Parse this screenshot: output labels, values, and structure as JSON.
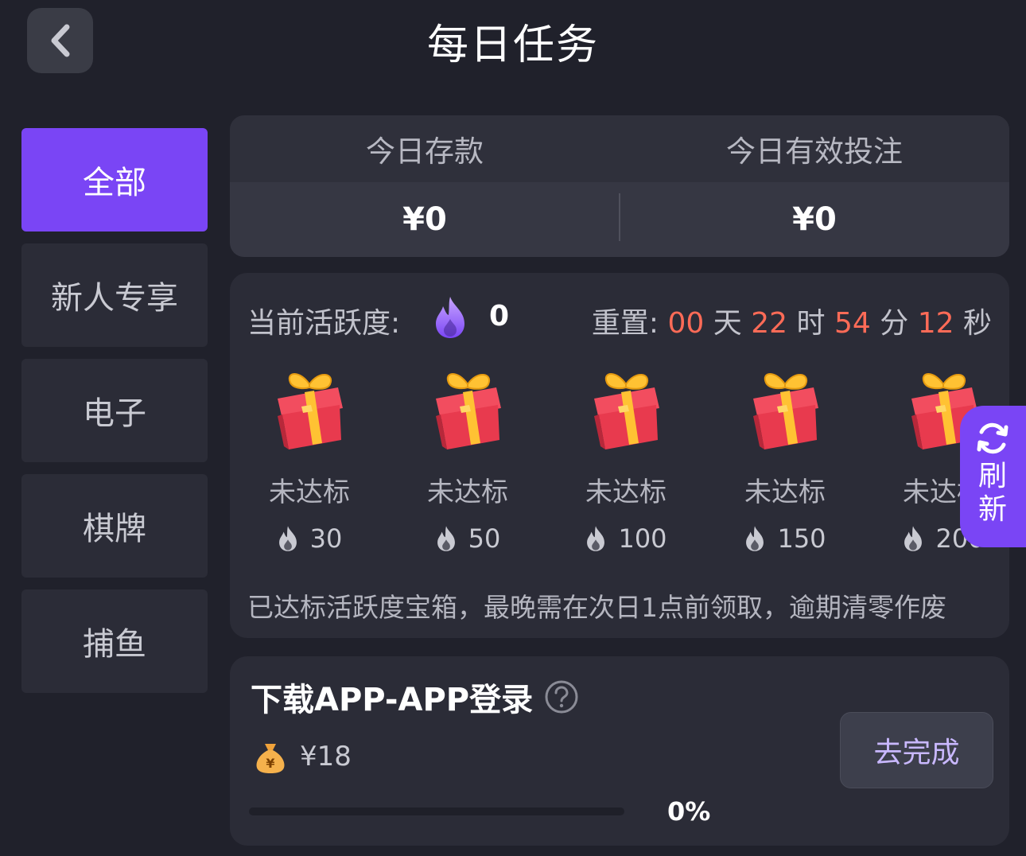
{
  "header": {
    "title": "每日任务",
    "back_icon": "chevron-left-icon"
  },
  "sidebar": {
    "items": [
      {
        "label": "全部",
        "active": true
      },
      {
        "label": "新人专享",
        "active": false
      },
      {
        "label": "电子",
        "active": false
      },
      {
        "label": "棋牌",
        "active": false
      },
      {
        "label": "捕鱼",
        "active": false
      }
    ]
  },
  "stats": {
    "deposit_label": "今日存款",
    "deposit_value": "¥0",
    "bet_label": "今日有效投注",
    "bet_value": "¥0"
  },
  "activity": {
    "label": "当前活跃度:",
    "value": "0",
    "reset_label": "重置:",
    "reset": {
      "days": "00",
      "days_unit": "天",
      "hours": "22",
      "hours_unit": "时",
      "minutes": "54",
      "minutes_unit": "分",
      "seconds": "12",
      "seconds_unit": "秒"
    },
    "rewards": [
      {
        "status": "未达标",
        "required": "30"
      },
      {
        "status": "未达标",
        "required": "50"
      },
      {
        "status": "未达标",
        "required": "100"
      },
      {
        "status": "未达标",
        "required": "150"
      },
      {
        "status": "未达标",
        "required": "200"
      }
    ],
    "notice": "已达标活跃度宝箱，最晚需在次日1点前领取，逾期清零作废"
  },
  "refresh": {
    "label": "刷新",
    "icon": "refresh-icon"
  },
  "task": {
    "title": "下载APP-APP登录",
    "reward": "¥18",
    "progress_percent": 0,
    "progress_text": "0%",
    "button_label": "去完成"
  },
  "colors": {
    "accent": "#7a45f5",
    "countdown": "#ff6b57",
    "background": "#20212b",
    "card": "#2b2c37"
  }
}
